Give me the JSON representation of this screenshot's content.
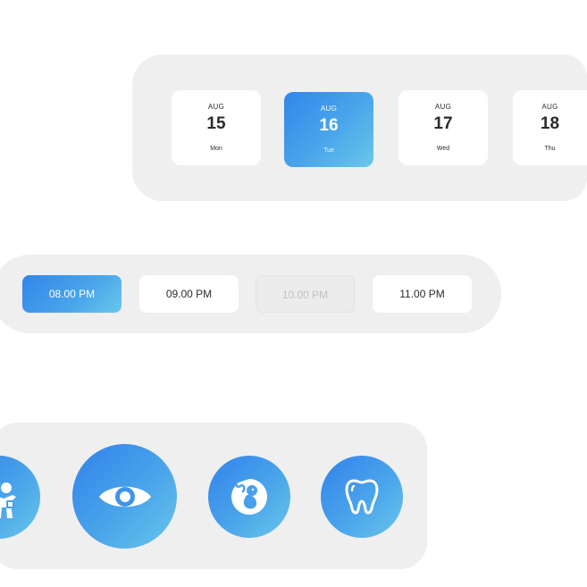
{
  "date_picker": {
    "dates": [
      {
        "month": "AUG",
        "day": "15",
        "weekday": "Mon",
        "selected": false
      },
      {
        "month": "AUG",
        "day": "16",
        "weekday": "Tue",
        "selected": true
      },
      {
        "month": "AUG",
        "day": "17",
        "weekday": "Wed",
        "selected": false
      },
      {
        "month": "AUG",
        "day": "18",
        "weekday": "Thu",
        "selected": false
      }
    ]
  },
  "time_picker": {
    "slots": [
      {
        "label": "08.00 PM",
        "state": "selected"
      },
      {
        "label": "09.00 PM",
        "state": "available"
      },
      {
        "label": "10.00 PM",
        "state": "disabled"
      },
      {
        "label": "11.00 PM",
        "state": "available"
      }
    ]
  },
  "categories": {
    "items": [
      {
        "icon": "doctor-icon",
        "selected": false
      },
      {
        "icon": "eye-icon",
        "selected": true
      },
      {
        "icon": "fetus-icon",
        "selected": false
      },
      {
        "icon": "tooth-icon",
        "selected": false
      }
    ]
  },
  "colors": {
    "accent_start": "#3182ea",
    "accent_end": "#69c6ea",
    "panel": "#efefef",
    "text": "#2b2b2b",
    "disabled_text": "#c2c2c2"
  }
}
